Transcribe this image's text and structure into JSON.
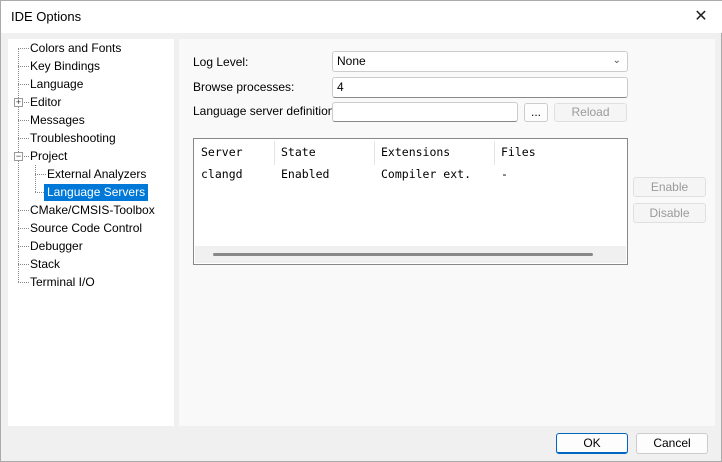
{
  "window": {
    "title": "IDE Options",
    "close_icon": "close-icon"
  },
  "tree": {
    "items": [
      {
        "label": "Colors and Fonts",
        "level": 0
      },
      {
        "label": "Key Bindings",
        "level": 0
      },
      {
        "label": "Language",
        "level": 0
      },
      {
        "label": "Editor",
        "level": 0,
        "expander": "+"
      },
      {
        "label": "Messages",
        "level": 0
      },
      {
        "label": "Troubleshooting",
        "level": 0
      },
      {
        "label": "Project",
        "level": 0,
        "expander": "−"
      },
      {
        "label": "External Analyzers",
        "level": 1
      },
      {
        "label": "Language Servers",
        "level": 1,
        "selected": true
      },
      {
        "label": "CMake/CMSIS-Toolbox",
        "level": 0
      },
      {
        "label": "Source Code Control",
        "level": 0
      },
      {
        "label": "Debugger",
        "level": 0
      },
      {
        "label": "Stack",
        "level": 0
      },
      {
        "label": "Terminal I/O",
        "level": 0
      }
    ]
  },
  "form": {
    "log_level_label": "Log Level:",
    "log_level_value": "None",
    "browse_label": "Browse processes:",
    "browse_value": "4",
    "defs_label": "Language server definitions:",
    "defs_value": "",
    "browse_button": "...",
    "reload_button": "Reload"
  },
  "servers": {
    "columns": [
      "Server",
      "State",
      "Extensions",
      "Files"
    ],
    "rows": [
      [
        "clangd",
        "Enabled",
        "Compiler ext.",
        "-"
      ]
    ]
  },
  "side_buttons": {
    "enable": "Enable",
    "disable": "Disable"
  },
  "footer": {
    "ok": "OK",
    "cancel": "Cancel"
  },
  "colors": {
    "selection": "#0078d7"
  }
}
